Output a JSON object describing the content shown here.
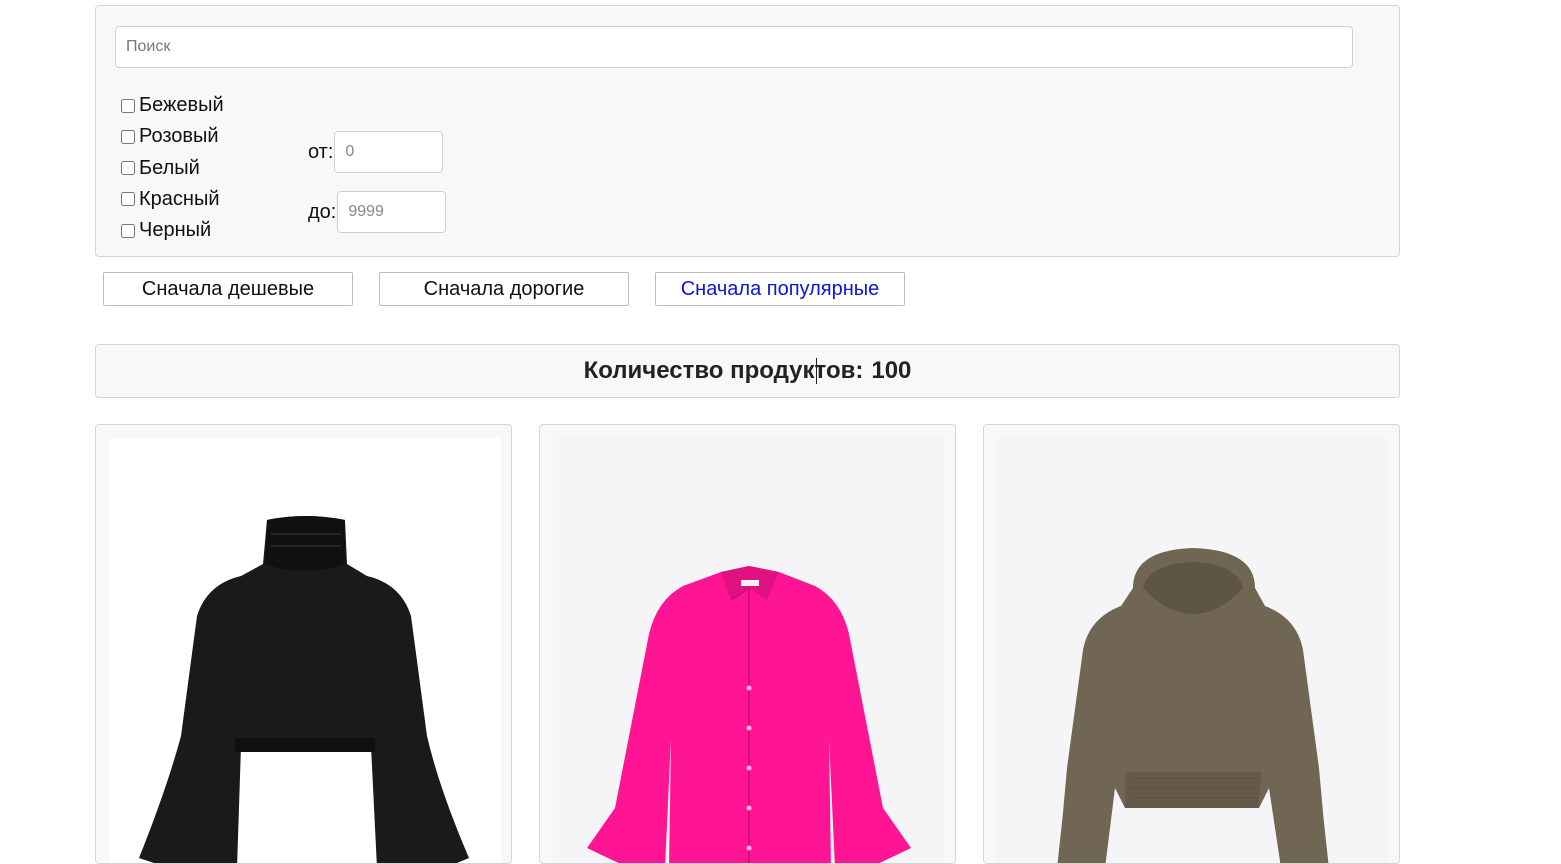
{
  "search": {
    "placeholder": "Поиск",
    "value": ""
  },
  "color_filters": [
    {
      "label": "Бежевый",
      "checked": false
    },
    {
      "label": "Розовый",
      "checked": false
    },
    {
      "label": "Белый",
      "checked": false
    },
    {
      "label": "Красный",
      "checked": false
    },
    {
      "label": "Черный",
      "checked": false
    }
  ],
  "price_filter": {
    "from_label": "от:",
    "from_placeholder": "0",
    "to_label": "до:",
    "to_placeholder": "9999"
  },
  "sort_buttons": [
    {
      "label": "Сначала дешевые",
      "active": false
    },
    {
      "label": "Сначала дорогие",
      "active": false
    },
    {
      "label": "Сначала популярные",
      "active": true
    }
  ],
  "product_count": {
    "label": "Количество продуктов:",
    "value": "100"
  },
  "products": [
    {
      "image": "black-turtleneck-sweater",
      "background": "#ffffff",
      "color": "#1a1a1a"
    },
    {
      "image": "pink-oversized-shirt",
      "background": "#f5f5f7",
      "color": "#ff1493"
    },
    {
      "image": "khaki-hoodie",
      "background": "#f5f5f7",
      "color": "#716654"
    }
  ],
  "colors": {
    "accent_active_text": "#0a16d6",
    "panel_bg": "#f8f8f8",
    "panel_border": "#d4d4d4"
  }
}
